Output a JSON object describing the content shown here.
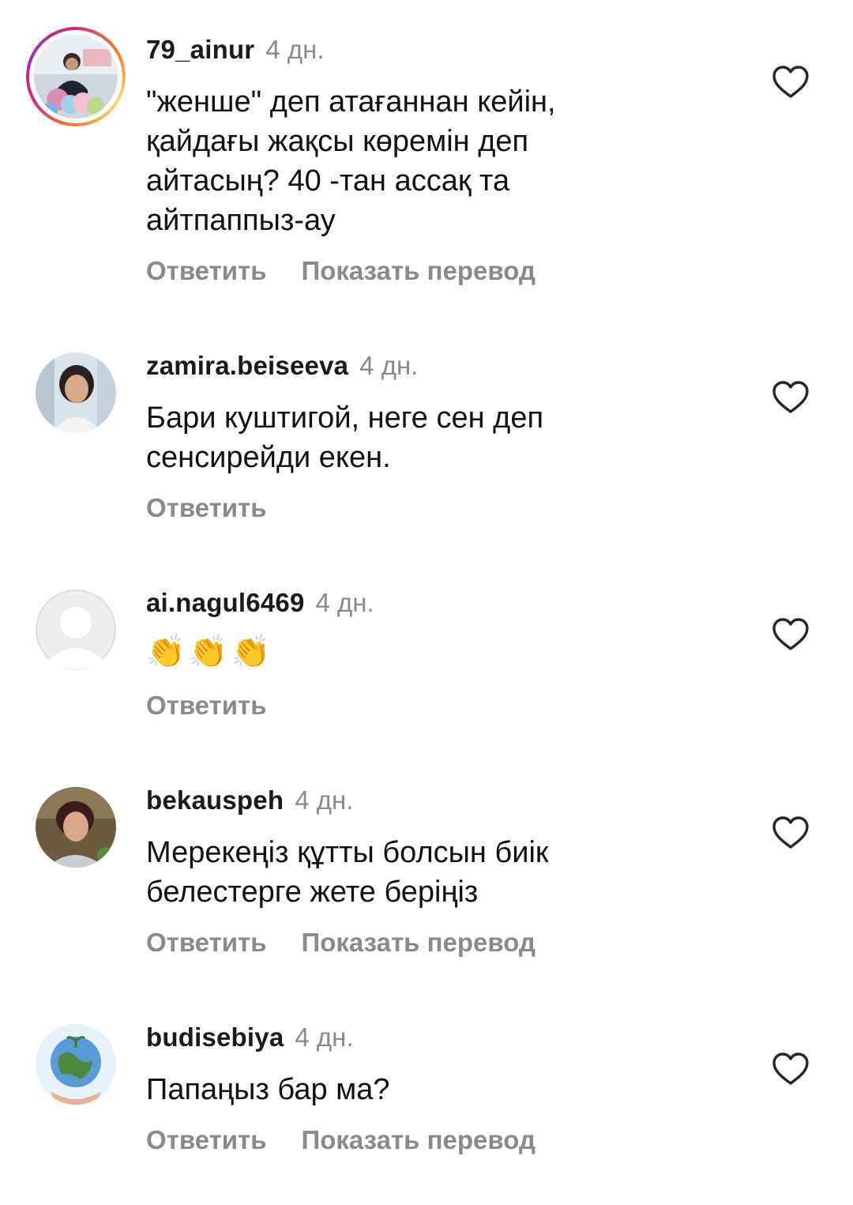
{
  "comments": [
    {
      "username": "79_ainur",
      "time": "4 дн.",
      "text": "\"женше\" деп атағаннан кейін, қайдағы жақсы көремін деп айтасың? 40 -тан ассақ та айтпаппыз-ау",
      "reply_label": "Ответить",
      "translate_label": "Показать перевод",
      "has_story_ring": true
    },
    {
      "username": "zamira.beiseeva",
      "time": "4 дн.",
      "text": "Бари куштигой, неге сен деп сенсирейди екен.",
      "reply_label": "Ответить"
    },
    {
      "username": "ai.nagul6469",
      "time": "4 дн.",
      "text": "👏👏👏",
      "reply_label": "Ответить"
    },
    {
      "username": "bekauspeh",
      "time": "4 дн.",
      "text": "Мерекеңіз құтты болсын биік белестерге жете беріңіз",
      "reply_label": "Ответить",
      "translate_label": "Показать перевод"
    },
    {
      "username": "budisebiya",
      "time": "4 дн.",
      "text": "Папаңыз бар ма?",
      "reply_label": "Ответить",
      "translate_label": "Показать перевод"
    }
  ],
  "icons": {
    "like": "heart-outline-icon",
    "default_avatar": "default-user-icon"
  },
  "colors": {
    "muted_text": "#8a8a8a",
    "story_ring": [
      "#d62976",
      "#fa7e1e",
      "#feda75",
      "#962fbf"
    ]
  }
}
